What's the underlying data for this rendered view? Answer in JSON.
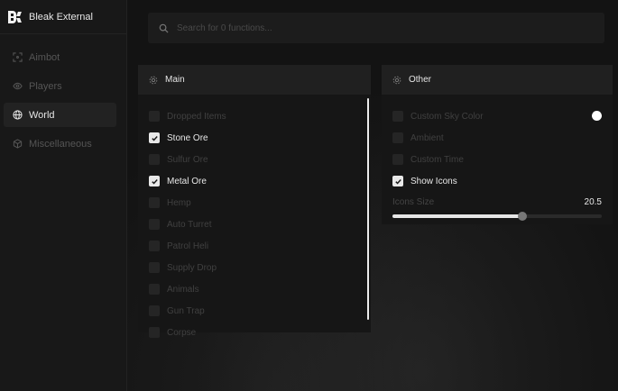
{
  "app": {
    "title": "Bleak External"
  },
  "sidebar": {
    "items": [
      {
        "label": "Aimbot",
        "icon": "crosshair-icon",
        "active": false
      },
      {
        "label": "Players",
        "icon": "eye-icon",
        "active": false
      },
      {
        "label": "World",
        "icon": "globe-icon",
        "active": true
      },
      {
        "label": "Miscellaneous",
        "icon": "cube-icon",
        "active": false
      }
    ]
  },
  "search": {
    "placeholder": "Search for 0 functions...",
    "value": ""
  },
  "main_panel": {
    "title": "Main",
    "items": [
      {
        "label": "Dropped Items",
        "checked": false
      },
      {
        "label": "Stone Ore",
        "checked": true
      },
      {
        "label": "Sulfur Ore",
        "checked": false
      },
      {
        "label": "Metal Ore",
        "checked": true
      },
      {
        "label": "Hemp",
        "checked": false
      },
      {
        "label": "Auto Turret",
        "checked": false
      },
      {
        "label": "Patrol Heli",
        "checked": false
      },
      {
        "label": "Supply Drop",
        "checked": false
      },
      {
        "label": "Animals",
        "checked": false
      },
      {
        "label": "Gun Trap",
        "checked": false
      },
      {
        "label": "Corpse",
        "checked": false
      }
    ]
  },
  "other_panel": {
    "title": "Other",
    "items": [
      {
        "label": "Custom Sky Color",
        "checked": false,
        "color": "#ffffff"
      },
      {
        "label": "Ambient",
        "checked": false
      },
      {
        "label": "Custom Time",
        "checked": false
      },
      {
        "label": "Show Icons",
        "checked": true
      }
    ],
    "slider": {
      "label": "Icons Size",
      "value_text": "20.5",
      "fraction": 0.62
    }
  },
  "colors": {
    "accent": "#e8e8e8",
    "background": "#131313",
    "panel": "#161616"
  }
}
